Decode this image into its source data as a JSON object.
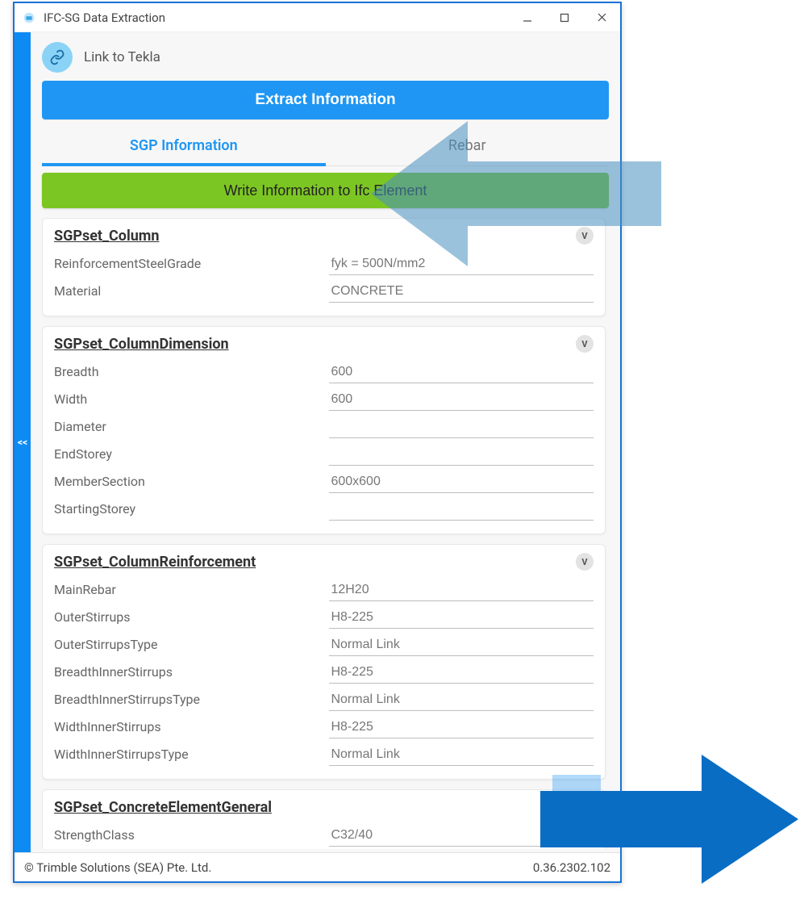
{
  "window": {
    "title": "IFC-SG Data Extraction"
  },
  "header": {
    "link_label": "Link to Tekla",
    "extract_label": "Extract Information"
  },
  "tabs": {
    "sgInfo": "SGP Information",
    "rebar": "Rebar"
  },
  "write_button": "Write Information to Ifc Element",
  "sidebar_toggle": "<<",
  "collapse_glyph": "V",
  "cards": {
    "c0": {
      "title": "SGPset_Column",
      "rows": [
        {
          "label": "ReinforcementSteelGrade",
          "value": "fyk = 500N/mm2"
        },
        {
          "label": "Material",
          "value": "CONCRETE"
        }
      ]
    },
    "c1": {
      "title": "SGPset_ColumnDimension",
      "rows": [
        {
          "label": "Breadth",
          "value": "600"
        },
        {
          "label": "Width",
          "value": "600"
        },
        {
          "label": "Diameter",
          "value": ""
        },
        {
          "label": "EndStorey",
          "value": ""
        },
        {
          "label": "MemberSection",
          "value": "600x600"
        },
        {
          "label": "StartingStorey",
          "value": ""
        }
      ]
    },
    "c2": {
      "title": "SGPset_ColumnReinforcement",
      "rows": [
        {
          "label": "MainRebar",
          "value": "12H20"
        },
        {
          "label": "OuterStirrups",
          "value": "H8-225"
        },
        {
          "label": "OuterStirrupsType",
          "value": "Normal Link"
        },
        {
          "label": "BreadthInnerStirrups",
          "value": "H8-225"
        },
        {
          "label": "BreadthInnerStirrupsType",
          "value": "Normal Link"
        },
        {
          "label": "WidthInnerStirrups",
          "value": "H8-225"
        },
        {
          "label": "WidthInnerStirrupsType",
          "value": "Normal Link"
        }
      ]
    },
    "c3": {
      "title": "SGPset_ConcreteElementGeneral",
      "rows": [
        {
          "label": "StrengthClass",
          "value": "C32/40"
        }
      ]
    }
  },
  "footer": {
    "copyright": "© Trimble Solutions (SEA) Pte. Ltd.",
    "version": "0.36.2302.102"
  }
}
